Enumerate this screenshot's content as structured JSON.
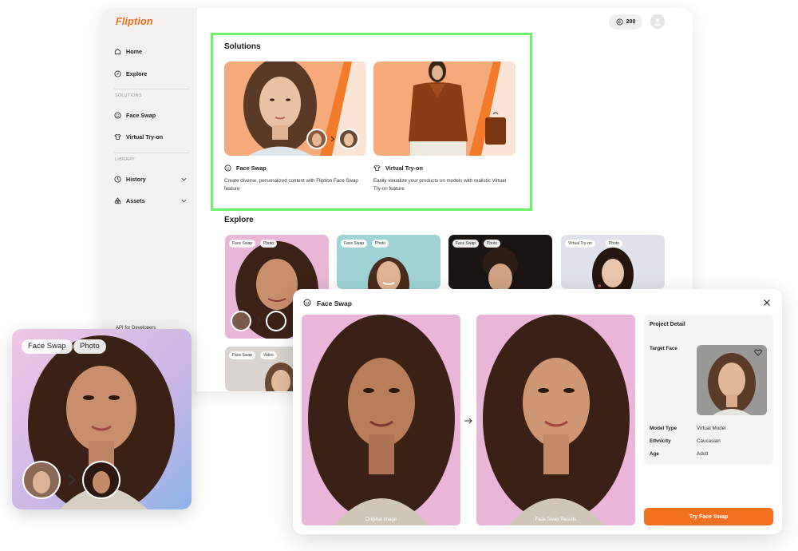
{
  "app": {
    "logo": "Fliption",
    "credits": "200",
    "nav": {
      "home": "Home",
      "explore": "Explore",
      "section_solutions": "SOLUTIONS",
      "face_swap": "Face Swap",
      "virtual_tryon": "Virtual Try-on",
      "section_library": "LIBRARY",
      "history": "History",
      "assets": "Assets",
      "api": "API for Developers"
    },
    "solutions": {
      "title": "Solutions",
      "cards": [
        {
          "title": "Face Swap",
          "description": "Create diverse, personalized content with Fliption Face Swap feature"
        },
        {
          "title": "Virtual Try-on",
          "description": "Easily visualize your products on models with realistic Virtual Try-on feature"
        }
      ]
    },
    "explore": {
      "title": "Explore",
      "cards": [
        {
          "tags": [
            "Face Swap",
            "Photo"
          ]
        },
        {
          "tags": [
            "Face Swap",
            "Photo"
          ]
        },
        {
          "tags": [
            "Face Swap",
            "Photo"
          ]
        },
        {
          "tags": [
            "Virtual Try-on",
            "Photo"
          ]
        },
        {
          "tags": [
            "Face Swap",
            "Video"
          ]
        }
      ]
    }
  },
  "float_card": {
    "tags": [
      "Face Swap",
      "Photo"
    ]
  },
  "modal": {
    "title": "Face Swap",
    "original_caption": "Original Image",
    "result_caption": "Face Swap Results",
    "detail": {
      "title": "Project Detail",
      "target_face_label": "Target Face",
      "model_type_label": "Model Type",
      "model_type_value": "Virtual Model",
      "ethnicity_label": "Ethnicity",
      "ethnicity_value": "Caucasian",
      "age_label": "Age",
      "age_value": "Adult"
    },
    "cta": "Try Face Swap"
  },
  "colors": {
    "brand_orange": "#f27121",
    "highlight_green": "#6cf26a",
    "sidebar_bg": "#f3f2f0"
  }
}
